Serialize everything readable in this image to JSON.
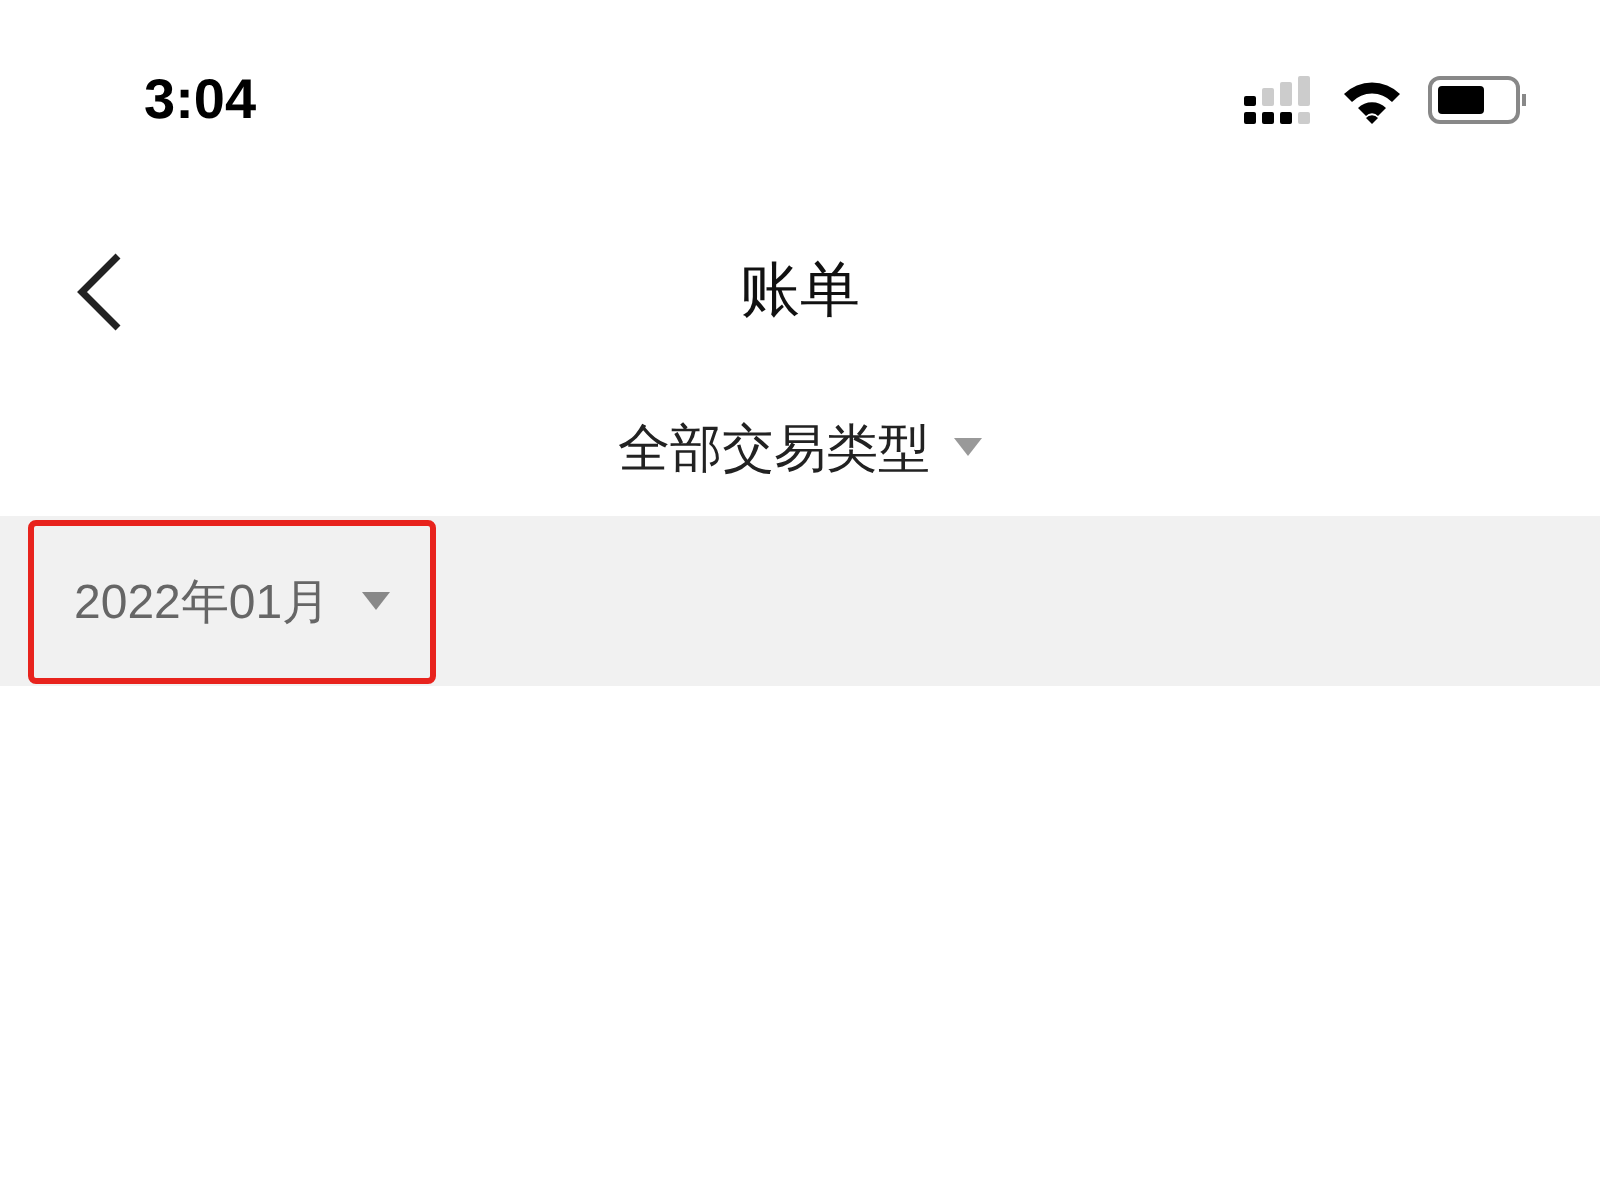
{
  "status_bar": {
    "time": "3:04"
  },
  "nav_bar": {
    "title": "账单"
  },
  "type_filter": {
    "label": "全部交易类型"
  },
  "month_filter": {
    "label": "2022年01月",
    "highlighted": true
  }
}
